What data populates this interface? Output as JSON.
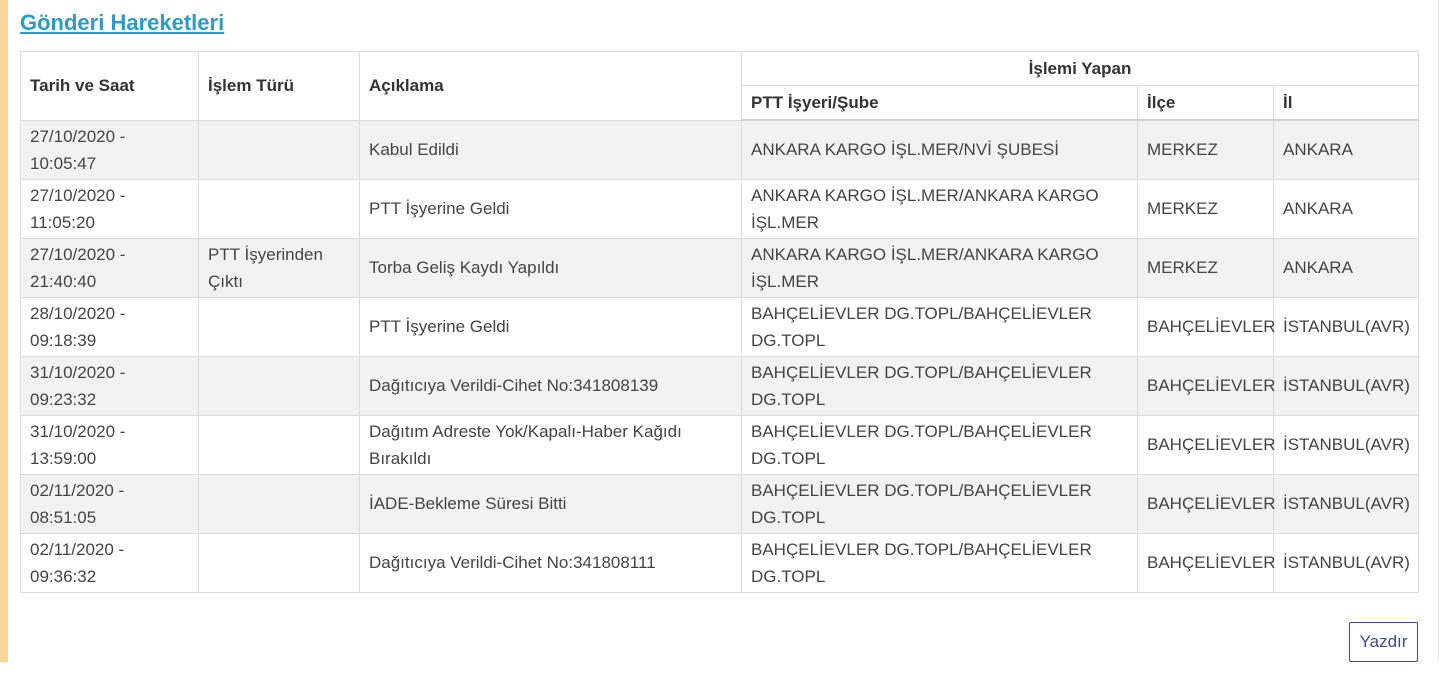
{
  "title": "Gönderi Hareketleri",
  "table": {
    "headers": {
      "date": "Tarih ve Saat",
      "type": "İşlem Türü",
      "desc": "Açıklama",
      "group": "İşlemi Yapan",
      "office": "PTT İşyeri/Şube",
      "district": "İlçe",
      "city": "İl"
    },
    "rows": [
      {
        "date": "27/10/2020 - 10:05:47",
        "type": "",
        "desc": "Kabul Edildi",
        "office": "ANKARA KARGO İŞL.MER/NVİ ŞUBESİ",
        "district": "MERKEZ",
        "city": "ANKARA"
      },
      {
        "date": "27/10/2020 - 11:05:20",
        "type": "",
        "desc": "PTT İşyerine Geldi",
        "office": "ANKARA KARGO İŞL.MER/ANKARA KARGO İŞL.MER",
        "district": "MERKEZ",
        "city": "ANKARA"
      },
      {
        "date": "27/10/2020 - 21:40:40",
        "type": "PTT İşyerinden Çıktı",
        "desc": "Torba Geliş Kaydı Yapıldı",
        "office": "ANKARA KARGO İŞL.MER/ANKARA KARGO İŞL.MER",
        "district": "MERKEZ",
        "city": "ANKARA"
      },
      {
        "date": "28/10/2020 - 09:18:39",
        "type": "",
        "desc": "PTT İşyerine Geldi",
        "office": "BAHÇELİEVLER DG.TOPL/BAHÇELİEVLER DG.TOPL",
        "district": "BAHÇELİEVLER",
        "city": "İSTANBUL(AVR)"
      },
      {
        "date": "31/10/2020 - 09:23:32",
        "type": "",
        "desc": "Dağıtıcıya Verildi-Cihet No:341808139",
        "office": "BAHÇELİEVLER DG.TOPL/BAHÇELİEVLER DG.TOPL",
        "district": "BAHÇELİEVLER",
        "city": "İSTANBUL(AVR)"
      },
      {
        "date": "31/10/2020 - 13:59:00",
        "type": "",
        "desc": "Dağıtım Adreste Yok/Kapalı-Haber Kağıdı Bırakıldı",
        "office": "BAHÇELİEVLER DG.TOPL/BAHÇELİEVLER DG.TOPL",
        "district": "BAHÇELİEVLER",
        "city": "İSTANBUL(AVR)"
      },
      {
        "date": "02/11/2020 - 08:51:05",
        "type": "",
        "desc": "İADE-Bekleme Süresi Bitti",
        "office": "BAHÇELİEVLER DG.TOPL/BAHÇELİEVLER DG.TOPL",
        "district": "BAHÇELİEVLER",
        "city": "İSTANBUL(AVR)"
      },
      {
        "date": "02/11/2020 - 09:36:32",
        "type": "",
        "desc": "Dağıtıcıya Verildi-Cihet No:341808111",
        "office": "BAHÇELİEVLER DG.TOPL/BAHÇELİEVLER DG.TOPL",
        "district": "BAHÇELİEVLER",
        "city": "İSTANBUL(AVR)"
      }
    ]
  },
  "print_label": "Yazdır",
  "colors": {
    "title": "#2b9bc8",
    "accent_bar": "#fbd49a",
    "print_button": "#3b4a8c",
    "row_stripe": "#f2f2f2",
    "border": "#dcdcdc"
  }
}
